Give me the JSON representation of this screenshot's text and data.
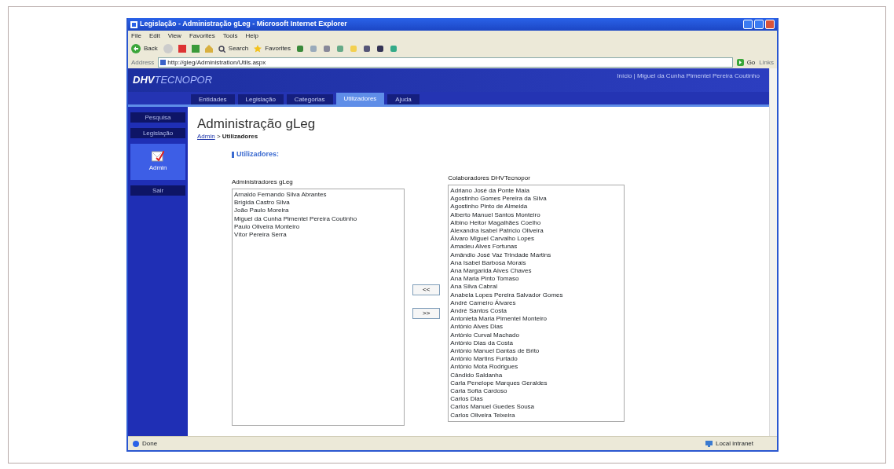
{
  "window": {
    "title": "Legislação - Administração gLeg - Microsoft Internet Explorer"
  },
  "menu": [
    "File",
    "Edit",
    "View",
    "Favorites",
    "Tools",
    "Help"
  ],
  "toolbar": {
    "back": "Back",
    "search": "Search",
    "favorites": "Favorites"
  },
  "address_bar": {
    "label": "Address",
    "url": "http://gleg/Administration/Utils.aspx",
    "go": "Go",
    "links": "Links"
  },
  "site": {
    "logo_bold": "DHV",
    "logo_rest": "TECNOPOR",
    "user_line": "Início | Miguel da Cunha Pimentel Pereira Coutinho"
  },
  "tabs": [
    {
      "label": "Entidades",
      "selected": false
    },
    {
      "label": "Legislação",
      "selected": false
    },
    {
      "label": "Categorias",
      "selected": false
    },
    {
      "label": "Utilizadores",
      "selected": true
    },
    {
      "label": "Ajuda",
      "selected": false
    }
  ],
  "sidebar": {
    "items": [
      {
        "label": "Pesquisa",
        "selected": false
      },
      {
        "label": "Legislação",
        "selected": false
      },
      {
        "label": "Admin",
        "selected": true
      },
      {
        "label": "Sair",
        "selected": false
      }
    ]
  },
  "page": {
    "heading": "Administração gLeg",
    "breadcrumb": {
      "link": "Admin",
      "separator": ">",
      "current": "Utilizadores"
    },
    "section": "Utilizadores:"
  },
  "admins": {
    "label": "Administradores gLeg",
    "items": [
      "Arnaldo Fernando Silva Abrantes",
      "Brígida Castro Silva",
      "João Paulo Moreira",
      "Miguel da Cunha Pimentel Pereira Coutinho",
      "Paulo Oliveira Monteiro",
      "Vítor Pereira Serra"
    ]
  },
  "move_buttons": [
    "<<",
    ">>"
  ],
  "collaborators": {
    "label": "Colaboradores DHVTecnopor",
    "items": [
      "Adriano José da Ponte Maia",
      "Agostinho Gomes Pereira da Silva",
      "Agostinho Pinto de Almeida",
      "Alberto Manuel Santos Monteiro",
      "Albino Heitor Magalhães Coelho",
      "Alexandra Isabel Patrício Oliveira",
      "Álvaro Miguel Carvalho Lopes",
      "Amadeu Alves Fortunas",
      "Amândio José Vaz Trindade Martins",
      "Ana Isabel Barbosa Morais",
      "Ana Margarida Alves Chaves",
      "Ana Maria Pinto Tomaso",
      "Ana Silva Cabral",
      "Anabela Lopes Pereira Salvador Gomes",
      "André Carneiro Álvares",
      "André Santos Costa",
      "Antonieta Maria Pimentel Monteiro",
      "António Alves Dias",
      "António Curval Machado",
      "António Dias da Costa",
      "António Manuel Dantas de Brito",
      "António Martins Furtado",
      "António Mota Rodrigues",
      "Cândido Saldanha",
      "Carla Penelope Marques Geraldes",
      "Carla Sofia Cardoso",
      "Carlos Dias",
      "Carlos Manuel Guedes Sousa",
      "Carlos Oliveira Teixeira"
    ]
  },
  "status_bar": {
    "text": "Done",
    "zone": "Local intranet"
  }
}
